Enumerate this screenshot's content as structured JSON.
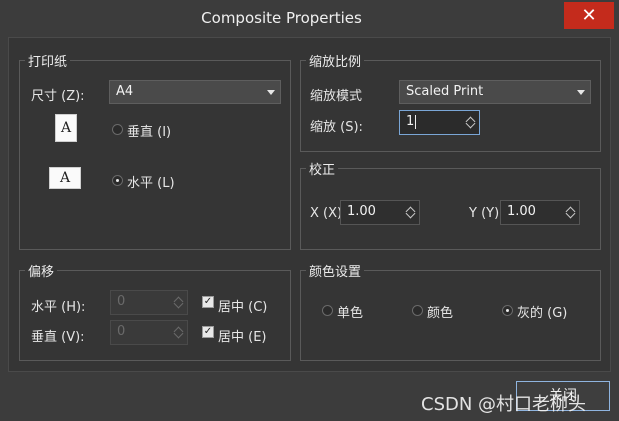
{
  "window": {
    "title": "Composite Properties",
    "close_glyph": "✕"
  },
  "print_paper": {
    "legend": "打印纸",
    "size_label": "尺寸 (Z):",
    "size_value": "A4",
    "portrait_icon_letter": "A",
    "landscape_icon_letter": "A",
    "portrait_label": "垂直 (I)",
    "landscape_label": "水平 (L)",
    "selected": "landscape"
  },
  "scaling": {
    "legend": "缩放比例",
    "mode_label": "缩放模式",
    "mode_value": "Scaled Print",
    "scale_label": "缩放 (S):",
    "scale_value": "1"
  },
  "correction": {
    "legend": "校正",
    "x_label": "X (X)",
    "x_value": "1.00",
    "y_label": "Y (Y)",
    "y_value": "1.00"
  },
  "offset": {
    "legend": "偏移",
    "h_label": "水平 (H):",
    "h_value": "0",
    "h_center_label": "居中 (C)",
    "v_label": "垂直 (V):",
    "v_value": "0",
    "v_center_label": "居中 (E)",
    "check_glyph": "✓"
  },
  "color": {
    "legend": "颜色设置",
    "mono": "单色",
    "color": "颜色",
    "gray": "灰的 (G)",
    "selected": "gray"
  },
  "footer": {
    "partial_button": "关闭",
    "watermark": "CSDN @村口老柳头"
  }
}
